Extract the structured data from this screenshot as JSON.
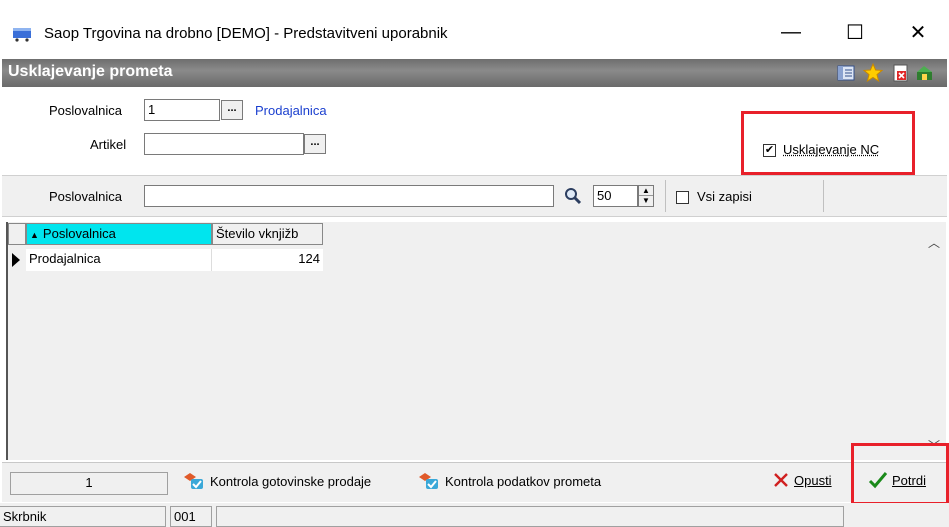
{
  "window": {
    "title": "Saop Trgovina na drobno [DEMO] - Predstavitveni uporabnik",
    "minimize_glyph": "—",
    "maximize_glyph": "☐",
    "close_glyph": "✕"
  },
  "form": {
    "title": "Usklajevanje prometa"
  },
  "filters": {
    "store_label": "Poslovalnica",
    "store_value": "1",
    "store_name": "Prodajalnica",
    "article_label": "Artikel",
    "article_value": "",
    "dots": "...",
    "sync_nc_label": "Usklajevanje NC",
    "sync_nc_checked": true
  },
  "search": {
    "label": "Poslovalnica",
    "value": "",
    "count": "50",
    "all_records_label": "Vsi zapisi",
    "all_records_checked": false
  },
  "grid": {
    "columns": [
      "Poslovalnica",
      "Število vknjižb"
    ],
    "rows": [
      {
        "poslovalnica": "Prodajalnica",
        "stevilo": "124"
      }
    ]
  },
  "toolbar": {
    "record_count": "1",
    "check_cash_sales": "Kontrola gotovinske prodaje",
    "check_traffic_data": "Kontrola podatkov prometa",
    "cancel": "Opusti",
    "confirm": "Potrdi"
  },
  "status": {
    "user": "Skrbnik",
    "code": "001",
    "extra": ""
  },
  "colors": {
    "highlight_red": "#e8202a",
    "header_cyan": "#00e5ee",
    "link_blue": "#1a3fcf",
    "confirm_green": "#1a8a1a",
    "cancel_red": "#d02020"
  }
}
